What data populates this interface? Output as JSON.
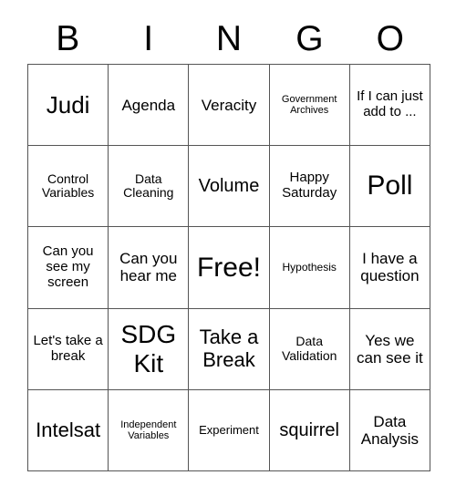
{
  "header": {
    "letters": [
      "B",
      "I",
      "N",
      "G",
      "O"
    ]
  },
  "grid": {
    "columns": 5,
    "rows": 5,
    "border_color": "#555555",
    "cell_background": "#ffffff",
    "text_color": "#000000",
    "cells": [
      {
        "text": "Judi",
        "size": "fs-3xl"
      },
      {
        "text": "Agenda",
        "size": "fs-lg"
      },
      {
        "text": "Veracity",
        "size": "fs-lg"
      },
      {
        "text": "Government Archives",
        "size": "fs-xs"
      },
      {
        "text": "If I can just add to ...",
        "size": "fs-mdl"
      },
      {
        "text": "Control Variables",
        "size": "fs-md"
      },
      {
        "text": "Data Cleaning",
        "size": "fs-md"
      },
      {
        "text": "Volume",
        "size": "fs-xl"
      },
      {
        "text": "Happy Saturday",
        "size": "fs-mdl"
      },
      {
        "text": "Poll",
        "size": "fs-5xl"
      },
      {
        "text": "Can you see my screen",
        "size": "fs-mdl"
      },
      {
        "text": "Can you hear me",
        "size": "fs-lg"
      },
      {
        "text": "Free!",
        "size": "fs-5xl"
      },
      {
        "text": "Hypothesis",
        "size": "fs-sm"
      },
      {
        "text": "I have a question",
        "size": "fs-lg"
      },
      {
        "text": "Let's take a break",
        "size": "fs-mdl"
      },
      {
        "text": "SDG Kit",
        "size": "fs-4xl"
      },
      {
        "text": "Take a Break",
        "size": "fs-2xl"
      },
      {
        "text": "Data Validation",
        "size": "fs-md"
      },
      {
        "text": "Yes we can see it",
        "size": "fs-lg"
      },
      {
        "text": "Intelsat",
        "size": "fs-2xl"
      },
      {
        "text": "Independent Variables",
        "size": "fs-xs"
      },
      {
        "text": "Experiment",
        "size": "fs-smm"
      },
      {
        "text": "squirrel",
        "size": "fs-xl"
      },
      {
        "text": "Data Analysis",
        "size": "fs-lg"
      }
    ]
  }
}
